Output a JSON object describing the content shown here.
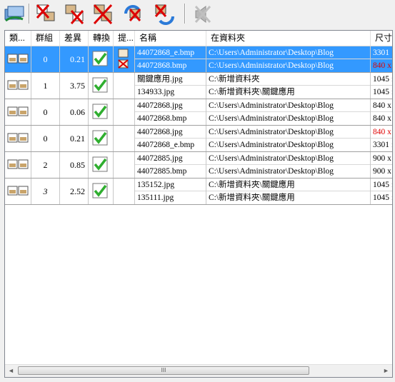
{
  "toolbar": {
    "buttons": [
      {
        "name": "refresh-scan-button",
        "icon": "scan-icon"
      },
      {
        "name": "delete-left-button",
        "icon": "delete-left-icon"
      },
      {
        "name": "delete-right-button",
        "icon": "delete-right-icon"
      },
      {
        "name": "delete-both-button",
        "icon": "delete-both-icon"
      },
      {
        "name": "move-left-button",
        "icon": "move-left-icon"
      },
      {
        "name": "move-right-button",
        "icon": "move-right-icon"
      },
      {
        "name": "mute-button",
        "icon": "speaker-mute-icon"
      }
    ]
  },
  "columns": [
    "類...",
    "群組",
    "差異",
    "轉換",
    "提...",
    "名稱",
    "在資料夾",
    "尺寸"
  ],
  "rows": [
    {
      "group": "0",
      "diff": "0.21",
      "selected": true,
      "hint": true,
      "files": [
        {
          "name": "44072868_e.bmp",
          "folder": "C:\\Users\\Administrator\\Desktop\\Blog",
          "size": "3301",
          "size_red": false
        },
        {
          "name": "44072868.bmp",
          "folder": "C:\\Users\\Administrator\\Desktop\\Blog",
          "size": "840 x",
          "size_red": true
        }
      ]
    },
    {
      "group": "1",
      "diff": "3.75",
      "selected": false,
      "hint": false,
      "files": [
        {
          "name": "關鍵應用.jpg",
          "folder": "C:\\新增資料夾",
          "size": "1045 :",
          "size_red": false
        },
        {
          "name": "134933.jpg",
          "folder": "C:\\新增資料夾\\關鍵應用",
          "size": "1045 :",
          "size_red": false
        }
      ]
    },
    {
      "group": "0",
      "diff": "0.06",
      "selected": false,
      "hint": false,
      "files": [
        {
          "name": "44072868.jpg",
          "folder": "C:\\Users\\Administrator\\Desktop\\Blog",
          "size": "840 x",
          "size_red": false
        },
        {
          "name": "44072868.bmp",
          "folder": "C:\\Users\\Administrator\\Desktop\\Blog",
          "size": "840 x",
          "size_red": false
        }
      ]
    },
    {
      "group": "0",
      "diff": "0.21",
      "selected": false,
      "hint": false,
      "files": [
        {
          "name": "44072868.jpg",
          "folder": "C:\\Users\\Administrator\\Desktop\\Blog",
          "size": "840 x",
          "size_red": true
        },
        {
          "name": "44072868_e.bmp",
          "folder": "C:\\Users\\Administrator\\Desktop\\Blog",
          "size": "3301 :",
          "size_red": false
        }
      ]
    },
    {
      "group": "2",
      "diff": "0.85",
      "selected": false,
      "hint": false,
      "files": [
        {
          "name": "44072885.jpg",
          "folder": "C:\\Users\\Administrator\\Desktop\\Blog",
          "size": "900 x",
          "size_red": false
        },
        {
          "name": "44072885.bmp",
          "folder": "C:\\Users\\Administrator\\Desktop\\Blog",
          "size": "900 x",
          "size_red": false
        }
      ]
    },
    {
      "group": "3",
      "diff": "2.52",
      "selected": false,
      "hint": false,
      "files": [
        {
          "name": "135152.jpg",
          "folder": "C:\\新增資料夾\\關鍵應用",
          "size": "1045 :",
          "size_red": false
        },
        {
          "name": "135111.jpg",
          "folder": "C:\\新增資料夾\\關鍵應用",
          "size": "1045 :",
          "size_red": false
        }
      ]
    }
  ],
  "scrollbar": {
    "left_arrow": "◄",
    "right_arrow": "►",
    "thumb_grip": "III"
  },
  "colors": {
    "selection": "#3399ff",
    "warning": "#e00000",
    "check": "#2fae2f"
  }
}
